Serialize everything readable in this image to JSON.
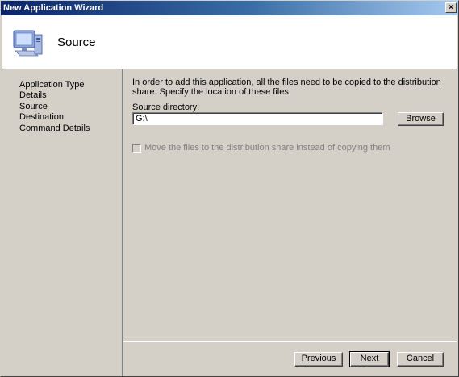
{
  "window": {
    "title": "New Application Wizard",
    "close_glyph": "×"
  },
  "header": {
    "title": "Source",
    "icon": "computer-icon"
  },
  "nav": {
    "items": [
      {
        "label": "Application Type"
      },
      {
        "label": "Details"
      },
      {
        "label": "Source"
      },
      {
        "label": "Destination"
      },
      {
        "label": "Command Details"
      }
    ]
  },
  "content": {
    "description": "In order to add this application, all the files need to be copied to the distribution share.  Specify the location of these files.",
    "source_label_mnemonic": "S",
    "source_label_rest": "ource directory:",
    "source_value": "G:\\",
    "browse_label": "Browse",
    "move_checkbox_label": "Move the files to the distribution share instead of copying them",
    "move_checkbox_checked": false
  },
  "footer": {
    "previous_mnemonic": "P",
    "previous_rest": "revious",
    "next_mnemonic": "N",
    "next_rest": "ext",
    "cancel_mnemonic": "C",
    "cancel_rest": "ancel"
  }
}
